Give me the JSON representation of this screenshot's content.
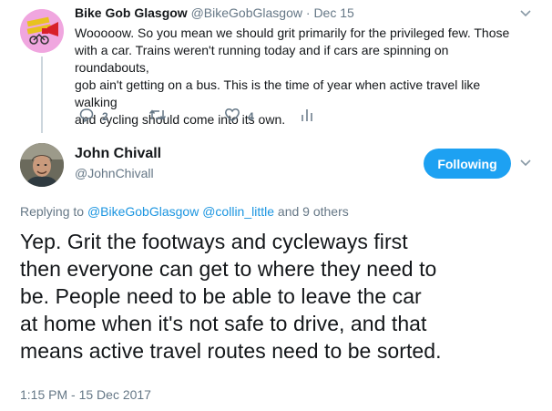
{
  "parent_tweet": {
    "avatar_text": "Bike Gob Glasgow",
    "display_name": "Bike Gob Glasgow",
    "handle": "@BikeGobGlasgow",
    "separator": "·",
    "date": "Dec 15",
    "lines": [
      "Wooooow. So you mean we should grit primarily for the privileged few. Those",
      "with a car. Trains weren't running today and if cars are spinning on roundabouts,",
      "gob ain't getting on a bus. This is the time of year when active travel like walking",
      "and cycling should come into its own."
    ],
    "reply_count": "2",
    "like_count": "4"
  },
  "main_tweet": {
    "display_name": "John Chivall",
    "handle": "@JohnChivall",
    "follow_label": "Following",
    "replying_prefix": "Replying to",
    "replying_to": [
      "@BikeGobGlasgow",
      "@collin_little"
    ],
    "replying_suffix": "and 9 others",
    "lines": [
      "Yep. Grit the footways and cycleways first",
      "then everyone can get to where they need to",
      "be. People need to be able to leave the car",
      "at home when it's not safe to drive, and that",
      "means active travel routes need to be sorted."
    ],
    "timestamp": "1:15 PM - 15 Dec 2017"
  },
  "icons": {
    "reply": "reply-icon",
    "retweet": "retweet-icon",
    "like": "heart-icon",
    "analytics": "analytics-icon",
    "more": "chevron-down-icon"
  },
  "colors": {
    "accent": "#1da1f2",
    "link": "#1b95e0",
    "muted": "#657786",
    "text": "#14171a"
  }
}
